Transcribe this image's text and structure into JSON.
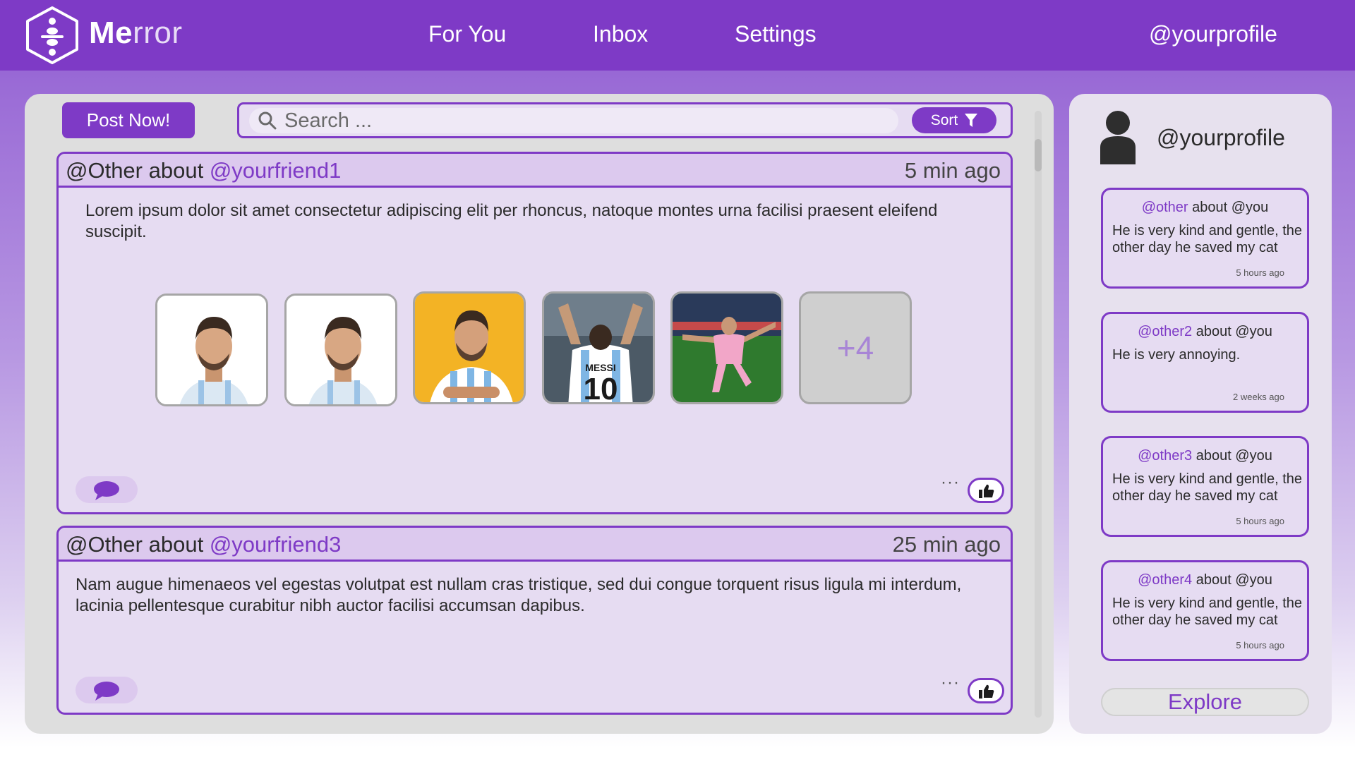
{
  "app": {
    "name_bold": "Me",
    "name_light": "rror"
  },
  "nav": {
    "for_you": "For You",
    "inbox": "Inbox",
    "settings": "Settings",
    "profile": "@yourprofile"
  },
  "feed": {
    "post_now_label": "Post Now!",
    "search_placeholder": "Search ...",
    "sort_label": "Sort",
    "posts": [
      {
        "author": "@Other about ",
        "mention": "@yourfriend1",
        "time": "5 min ago",
        "body": "Lorem ipsum dolor sit amet consectetur adipiscing elit per rhoncus, natoque montes urna facilisi praesent eleifend suscipit.",
        "more_images_label": "+4"
      },
      {
        "author": "@Other about ",
        "mention": "@yourfriend3",
        "time": "25 min ago",
        "body": "Nam augue himenaeos vel egestas volutpat est nullam cras tristique, sed  dui congue torquent risus ligula mi interdum, lacinia pellentesque  curabitur nibh auctor facilisi accumsan dapibus."
      }
    ],
    "more_label": "···"
  },
  "sidebar": {
    "profile": "@yourprofile",
    "notes": [
      {
        "author": "@other",
        "about": " about @you",
        "text": "He is very kind and gentle, the other day he saved my cat",
        "time": "5 hours ago"
      },
      {
        "author": "@other2",
        "about": " about @you",
        "text": "He is very annoying.",
        "time": "2 weeks ago"
      },
      {
        "author": "@other3",
        "about": " about @you",
        "text": "He is very kind and gentle, the other day he saved my cat",
        "time": "5 hours ago"
      },
      {
        "author": "@other4",
        "about": " about @you",
        "text": "He is very kind and gentle, the other day he saved my cat",
        "time": "5 hours ago"
      }
    ],
    "explore_label": "Explore"
  },
  "colors": {
    "accent": "#7e3ac6",
    "card_bg": "#e6dcf2",
    "header_bg": "#dcc9ee"
  },
  "icons": [
    "logo-icon",
    "search-icon",
    "filter-icon",
    "comment-icon",
    "thumbs-up-icon",
    "avatar-icon"
  ]
}
